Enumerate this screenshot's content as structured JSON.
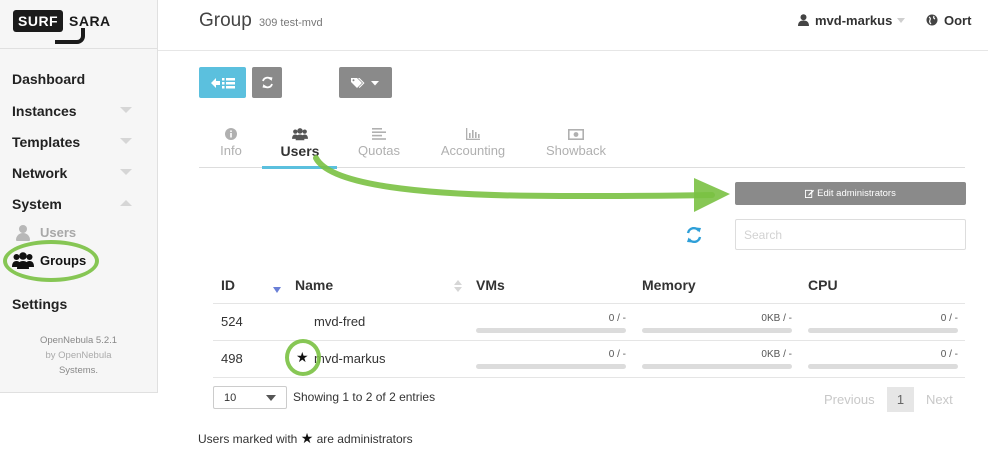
{
  "logo": {
    "left": "SURF",
    "right": "SARA"
  },
  "sidebar": {
    "items": [
      {
        "label": "Dashboard"
      },
      {
        "label": "Instances"
      },
      {
        "label": "Templates"
      },
      {
        "label": "Network"
      },
      {
        "label": "System"
      },
      {
        "label": "Users"
      },
      {
        "label": "Groups"
      },
      {
        "label": "Settings"
      }
    ],
    "version": [
      "OpenNebula 5.2.1",
      "by OpenNebula",
      "Systems."
    ]
  },
  "header": {
    "title": "Group",
    "subtitle": "309 test-mvd",
    "user": "mvd-markus",
    "zone": "Oort"
  },
  "tabs": [
    {
      "label": "Info"
    },
    {
      "label": "Users"
    },
    {
      "label": "Quotas"
    },
    {
      "label": "Accounting"
    },
    {
      "label": "Showback"
    }
  ],
  "actions": {
    "edit_admins": "Edit administrators",
    "search_placeholder": "Search"
  },
  "table": {
    "columns": [
      "ID",
      "Name",
      "VMs",
      "Memory",
      "CPU"
    ],
    "rows": [
      {
        "id": "524",
        "name": "mvd-fred",
        "admin": false,
        "vms": "0 / -",
        "memory": "0KB / -",
        "cpu": "0 / -"
      },
      {
        "id": "498",
        "name": "mvd-markus",
        "admin": true,
        "vms": "0 / -",
        "memory": "0KB / -",
        "cpu": "0 / -"
      }
    ]
  },
  "footer": {
    "page_size": "10",
    "showing": "Showing 1 to 2 of 2 entries",
    "previous": "Previous",
    "current_page": "1",
    "next": "Next",
    "note_before": "Users marked with",
    "note_after": "are administrators",
    "star": "★"
  },
  "colors": {
    "accent": "#5bc0de",
    "annotation": "#7ac143",
    "button_grey": "#8a8a8a",
    "sort_arrow": "#6a7fd6"
  }
}
